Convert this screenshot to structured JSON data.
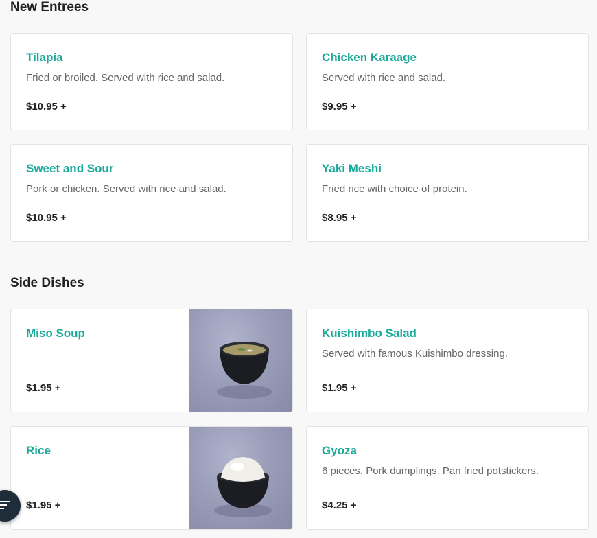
{
  "sections": [
    {
      "title": "New Entrees",
      "items": [
        {
          "name": "Tilapia",
          "description": "Fried or broiled. Served with rice and salad.",
          "price": "$10.95 +"
        },
        {
          "name": "Chicken Karaage",
          "description": "Served with rice and salad.",
          "price": "$9.95 +"
        },
        {
          "name": "Sweet and Sour",
          "description": "Pork or chicken. Served with rice and salad.",
          "price": "$10.95 +"
        },
        {
          "name": "Yaki Meshi",
          "description": "Fried rice with choice of protein.",
          "price": "$8.95 +"
        }
      ]
    },
    {
      "title": "Side Dishes",
      "items": [
        {
          "name": "Miso Soup",
          "description": "",
          "price": "$1.95 +",
          "photo": "miso-soup-bowl"
        },
        {
          "name": "Kuishimbo Salad",
          "description": "Served with famous Kuishimbo dressing.",
          "price": "$1.95 +"
        },
        {
          "name": "Rice",
          "description": "",
          "price": "$1.95 +",
          "photo": "rice-bowl"
        },
        {
          "name": "Gyoza",
          "description": "6 pieces. Pork dumplings. Pan fried potstickers.",
          "price": "$4.25 +"
        }
      ]
    }
  ],
  "colors": {
    "accent": "#1aaa9a",
    "fab": "#1f2d3a"
  },
  "fab_icon": "filter-lines-icon"
}
